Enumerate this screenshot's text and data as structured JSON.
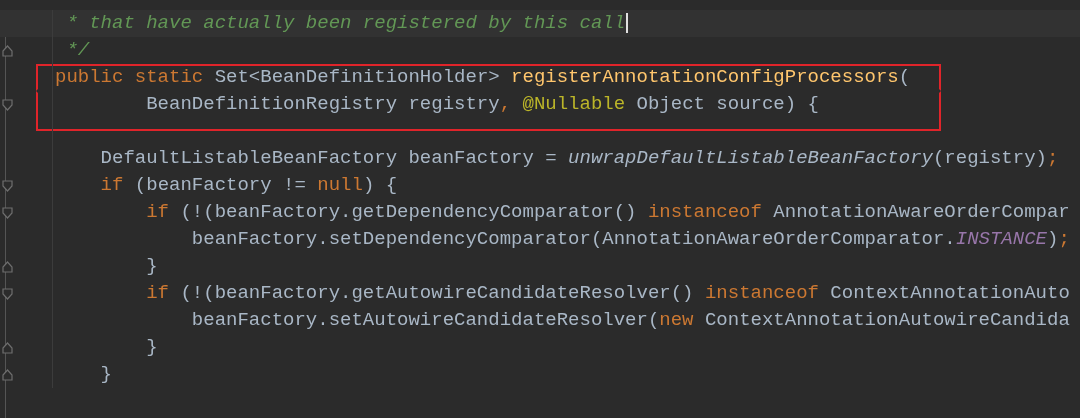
{
  "editor": {
    "lines": [
      {
        "fold_start": false,
        "fold_end": false,
        "highlighted": false,
        "current": true,
        "tokens": [
          {
            "kind": "comment",
            "text": " * that have actually been registered by this call"
          }
        ]
      },
      {
        "fold_start": false,
        "fold_end": true,
        "highlighted": false,
        "current": false,
        "tokens": [
          {
            "kind": "comment",
            "text": " */"
          }
        ]
      },
      {
        "fold_start": false,
        "fold_end": false,
        "highlighted": true,
        "current": false,
        "tokens": [
          {
            "kind": "keyword",
            "text": "public static "
          },
          {
            "kind": "plain",
            "text": "Set<BeanDefinitionHolder> "
          },
          {
            "kind": "method",
            "text": "registerAnnotationConfigProcessors"
          },
          {
            "kind": "plain",
            "text": "("
          }
        ]
      },
      {
        "fold_start": true,
        "fold_end": false,
        "highlighted": true,
        "current": false,
        "tokens": [
          {
            "kind": "plain",
            "text": "        BeanDefinitionRegistry registry"
          },
          {
            "kind": "keyword",
            "text": ", "
          },
          {
            "kind": "annotation",
            "text": "@Nullable "
          },
          {
            "kind": "plain",
            "text": "Object source) {"
          }
        ]
      },
      {
        "fold_start": false,
        "fold_end": false,
        "highlighted": false,
        "current": false
      },
      {
        "fold_start": false,
        "fold_end": false,
        "highlighted": false,
        "current": false,
        "tokens": [
          {
            "kind": "plain",
            "text": "    DefaultListableBeanFactory beanFactory = "
          },
          {
            "kind": "call",
            "text": "unwrapDefaultListableBeanFactory"
          },
          {
            "kind": "plain",
            "text": "(registry)"
          },
          {
            "kind": "keyword",
            "text": ";"
          }
        ]
      },
      {
        "fold_start": true,
        "fold_end": false,
        "highlighted": false,
        "current": false,
        "tokens": [
          {
            "kind": "keyword",
            "text": "    if "
          },
          {
            "kind": "plain",
            "text": "(beanFactory != "
          },
          {
            "kind": "keyword",
            "text": "null"
          },
          {
            "kind": "plain",
            "text": ") {"
          }
        ]
      },
      {
        "fold_start": true,
        "fold_end": false,
        "highlighted": false,
        "current": false,
        "tokens": [
          {
            "kind": "keyword",
            "text": "        if "
          },
          {
            "kind": "plain",
            "text": "(!(beanFactory.getDependencyComparator() "
          },
          {
            "kind": "keyword",
            "text": "instanceof "
          },
          {
            "kind": "plain",
            "text": "AnnotationAwareOrderCompar"
          }
        ]
      },
      {
        "fold_start": false,
        "fold_end": false,
        "highlighted": false,
        "current": false,
        "tokens": [
          {
            "kind": "plain",
            "text": "            beanFactory.setDependencyComparator(AnnotationAwareOrderComparator."
          },
          {
            "kind": "static_field",
            "text": "INSTANCE"
          },
          {
            "kind": "plain",
            "text": ")"
          },
          {
            "kind": "keyword",
            "text": ";"
          }
        ]
      },
      {
        "fold_start": false,
        "fold_end": true,
        "highlighted": false,
        "current": false,
        "tokens": [
          {
            "kind": "plain",
            "text": "        }"
          }
        ]
      },
      {
        "fold_start": true,
        "fold_end": false,
        "highlighted": false,
        "current": false,
        "tokens": [
          {
            "kind": "keyword",
            "text": "        if "
          },
          {
            "kind": "plain",
            "text": "(!(beanFactory.getAutowireCandidateResolver() "
          },
          {
            "kind": "keyword",
            "text": "instanceof "
          },
          {
            "kind": "plain",
            "text": "ContextAnnotationAuto"
          }
        ]
      },
      {
        "fold_start": false,
        "fold_end": false,
        "highlighted": false,
        "current": false,
        "tokens": [
          {
            "kind": "plain",
            "text": "            beanFactory.setAutowireCandidateResolver("
          },
          {
            "kind": "keyword",
            "text": "new "
          },
          {
            "kind": "plain",
            "text": "ContextAnnotationAutowireCandida"
          }
        ]
      },
      {
        "fold_start": false,
        "fold_end": true,
        "highlighted": false,
        "current": false,
        "tokens": [
          {
            "kind": "plain",
            "text": "        }"
          }
        ]
      },
      {
        "fold_start": false,
        "fold_end": true,
        "highlighted": false,
        "current": false,
        "tokens": [
          {
            "kind": "plain",
            "text": "    }"
          }
        ]
      }
    ]
  }
}
